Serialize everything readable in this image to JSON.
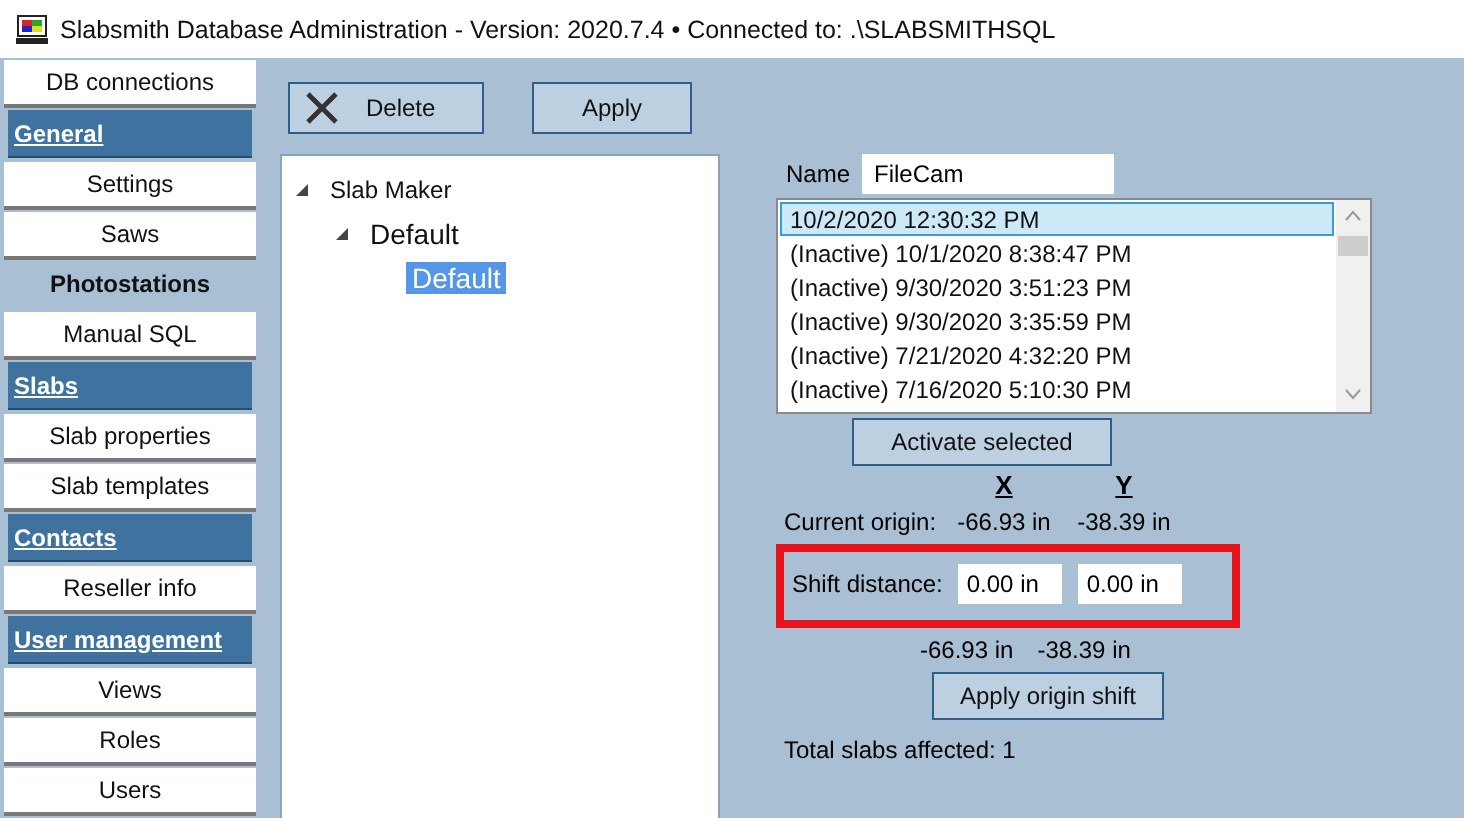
{
  "window": {
    "title": "Slabsmith Database Administration - Version: 2020.7.4 •  Connected to: .\\SLABSMITHSQL"
  },
  "sidebar": {
    "items": [
      {
        "label": "DB connections",
        "kind": "item",
        "selected": false
      },
      {
        "label": "General",
        "kind": "header"
      },
      {
        "label": "Settings",
        "kind": "item",
        "selected": false
      },
      {
        "label": "Saws",
        "kind": "item",
        "selected": false
      },
      {
        "label": "Photostations",
        "kind": "item",
        "selected": true
      },
      {
        "label": "Manual SQL",
        "kind": "item",
        "selected": false
      },
      {
        "label": "Slabs",
        "kind": "header"
      },
      {
        "label": "Slab properties",
        "kind": "item",
        "selected": false
      },
      {
        "label": "Slab templates",
        "kind": "item",
        "selected": false
      },
      {
        "label": "Contacts",
        "kind": "header"
      },
      {
        "label": "Reseller info",
        "kind": "item",
        "selected": false
      },
      {
        "label": "User management",
        "kind": "header"
      },
      {
        "label": "Views",
        "kind": "item",
        "selected": false
      },
      {
        "label": "Roles",
        "kind": "item",
        "selected": false
      },
      {
        "label": "Users",
        "kind": "item",
        "selected": false
      }
    ]
  },
  "toolbar": {
    "buttons": [
      "Delete",
      "Apply"
    ]
  },
  "tree": [
    {
      "label": "Slab Maker",
      "expanded": true,
      "selected": false,
      "children": [
        {
          "label": "Default",
          "expanded": true,
          "selected": false,
          "children": [
            {
              "label": "Default",
              "selected": true
            }
          ]
        }
      ]
    }
  ],
  "details": {
    "name_label": "Name",
    "name_value": "FileCam",
    "versions": [
      {
        "label": "10/2/2020 12:30:32 PM",
        "selected": true
      },
      {
        "label": "(Inactive) 10/1/2020 8:38:47 PM",
        "selected": false
      },
      {
        "label": "(Inactive) 9/30/2020 3:51:23 PM",
        "selected": false
      },
      {
        "label": "(Inactive) 9/30/2020 3:35:59 PM",
        "selected": false
      },
      {
        "label": "(Inactive) 7/21/2020 4:32:20 PM",
        "selected": false
      },
      {
        "label": "(Inactive) 7/16/2020 5:10:30 PM",
        "selected": false
      }
    ],
    "activate_button": "Activate selected",
    "x_header": "X",
    "y_header": "Y",
    "current_origin_label": "Current origin:",
    "current_x": "-66.93 in",
    "current_y": "-38.39 in",
    "shift_label": "Shift distance:",
    "shift_x": "0.00 in",
    "shift_y": "0.00 in",
    "shift_highlighted": true,
    "new_x": "-66.93 in",
    "new_y": "-38.39 in",
    "apply_shift_button": "Apply origin shift",
    "total": "Total slabs affected: 1"
  }
}
